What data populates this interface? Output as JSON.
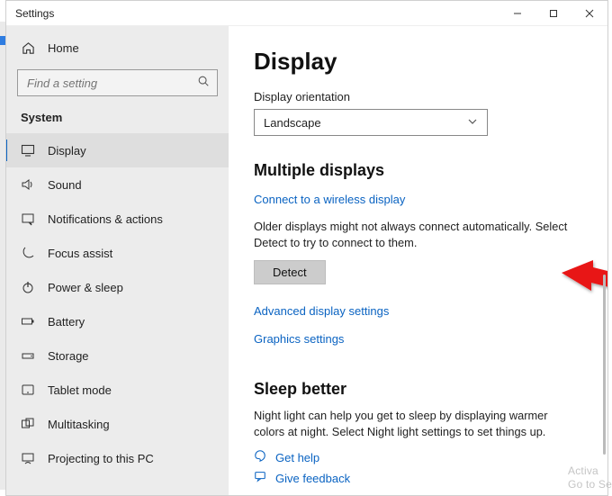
{
  "titlebar": {
    "title": "Settings"
  },
  "sidebar": {
    "home": "Home",
    "search_placeholder": "Find a setting",
    "group": "System",
    "items": [
      {
        "label": "Display"
      },
      {
        "label": "Sound"
      },
      {
        "label": "Notifications & actions"
      },
      {
        "label": "Focus assist"
      },
      {
        "label": "Power & sleep"
      },
      {
        "label": "Battery"
      },
      {
        "label": "Storage"
      },
      {
        "label": "Tablet mode"
      },
      {
        "label": "Multitasking"
      },
      {
        "label": "Projecting to this PC"
      }
    ]
  },
  "content": {
    "heading": "Display",
    "orientation_label": "Display orientation",
    "orientation_value": "Landscape",
    "multiple_heading": "Multiple displays",
    "wireless_link": "Connect to a wireless display",
    "older_text": "Older displays might not always connect automatically. Select Detect to try to connect to them.",
    "detect_label": "Detect",
    "advanced_link": "Advanced display settings",
    "graphics_link": "Graphics settings",
    "sleep_heading": "Sleep better",
    "sleep_text": "Night light can help you get to sleep by displaying warmer colors at night. Select Night light settings to set things up.",
    "get_help": "Get help",
    "give_feedback": "Give feedback"
  },
  "watermark": {
    "line1": "Activa",
    "line2": "Go to Se"
  }
}
